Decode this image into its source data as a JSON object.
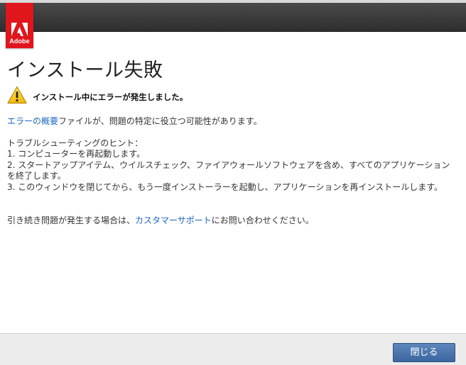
{
  "header": {
    "logo_text": "Adobe",
    "brand_color": "#e1161d",
    "icon": "adobe-logo-icon"
  },
  "page": {
    "title": "インストール失敗"
  },
  "warning": {
    "icon": "warning-icon",
    "text": "インストール中にエラーが発生しました。"
  },
  "summary": {
    "link_text": "エラーの概要",
    "rest_text": "ファイルが、問題の特定に役立つ可能性があります。"
  },
  "tips": {
    "heading": "トラブルシューティングのヒント：",
    "items": [
      "1. コンピューターを再起動します。",
      "2. スタートアップアイテム、ウイルスチェック、ファイアウォールソフトウェアを含め、すべてのアプリケーションを終了します。",
      "3. このウィンドウを閉じてから、もう一度インストーラーを起動し、アプリケーションを再インストールします。"
    ]
  },
  "support": {
    "prefix": "引き続き問題が発生する場合は、",
    "link_text": "カスタマーサポート",
    "suffix": "にお問い合わせください。"
  },
  "footer": {
    "close_label": "閉じる"
  },
  "colors": {
    "link": "#1a66c2",
    "button": "#3b66a0"
  }
}
